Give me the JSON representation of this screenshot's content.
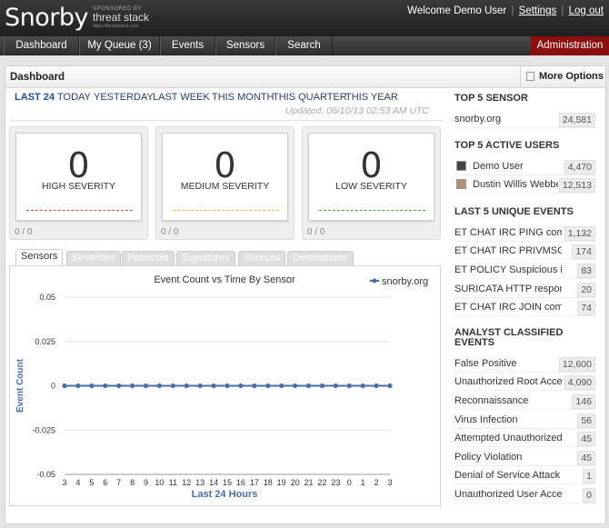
{
  "app": {
    "logo": "Snorby",
    "sponsor_small": "SPONSORED BY",
    "sponsor_brand": "threat stack",
    "sponsor_url": "https://threatstack.com",
    "welcome": "Welcome Demo User",
    "settings_link": "Settings",
    "logout_link": "Log out"
  },
  "nav": {
    "items": [
      "Dashboard",
      "My Queue (3)",
      "Events",
      "Sensors",
      "Search"
    ],
    "admin": "Administration"
  },
  "panel": {
    "title": "Dashboard",
    "more_options": "More Options"
  },
  "time_filters": [
    "LAST 24",
    "TODAY",
    "YESTERDAY",
    "LAST WEEK",
    "THIS MONTH",
    "THIS QUARTER",
    "THIS YEAR"
  ],
  "updated": "Updated: 06/10/13 02:53 AM UTC",
  "severities": [
    {
      "count": "0",
      "label": "HIGH SEVERITY",
      "ratio": "0 / 0",
      "color": "#d9534f"
    },
    {
      "count": "0",
      "label": "MEDIUM SEVERITY",
      "ratio": "0 / 0",
      "color": "#e6b949"
    },
    {
      "count": "0",
      "label": "LOW SEVERITY",
      "ratio": "0 / 0",
      "color": "#5a9a4a"
    }
  ],
  "tabs": [
    "Sensors",
    "Severities",
    "Protocols",
    "Signatures",
    "Sources",
    "Destinations"
  ],
  "chart_data": {
    "type": "line",
    "title": "Event Count vs Time By Sensor",
    "xlabel": "Last 24 Hours",
    "ylabel": "Event Count",
    "categories": [
      "3",
      "4",
      "5",
      "6",
      "7",
      "8",
      "9",
      "10",
      "11",
      "12",
      "13",
      "14",
      "15",
      "16",
      "17",
      "18",
      "19",
      "20",
      "21",
      "22",
      "23",
      "0",
      "1",
      "2",
      "3"
    ],
    "series": [
      {
        "name": "snorby.org",
        "values": [
          0,
          0,
          0,
          0,
          0,
          0,
          0,
          0,
          0,
          0,
          0,
          0,
          0,
          0,
          0,
          0,
          0,
          0,
          0,
          0,
          0,
          0,
          0,
          0,
          0
        ],
        "color": "#4a6fa5"
      }
    ],
    "ylim": [
      -0.05,
      0.05
    ],
    "yticks": [
      "0.05",
      "0.025",
      "0",
      "-0.025",
      "-0.05"
    ],
    "grid": true,
    "legend": "top-right"
  },
  "sidebar": {
    "top_sensor": {
      "title": "TOP 5 SENSOR",
      "rows": [
        {
          "name": "snorby.org",
          "value": "24,581"
        }
      ]
    },
    "top_users": {
      "title": "TOP 5 ACTIVE USERS",
      "rows": [
        {
          "name": "Demo User",
          "value": "4,470"
        },
        {
          "name": "Dustin Willis Webber",
          "value": "12,513"
        }
      ]
    },
    "unique_events": {
      "title": "LAST 5 UNIQUE EVENTS",
      "rows": [
        {
          "name": "ET CHAT IRC PING command",
          "value": "1,132"
        },
        {
          "name": "ET CHAT IRC PRIVMSG",
          "value": "174"
        },
        {
          "name": "ET POLICY Suspicious inbound",
          "value": "83"
        },
        {
          "name": "SURICATA HTTP response field",
          "value": "20"
        },
        {
          "name": "ET CHAT IRC JOIN command",
          "value": "74"
        }
      ]
    },
    "classified": {
      "title": "ANALYST CLASSIFIED EVENTS",
      "rows": [
        {
          "name": "False Positive",
          "value": "12,600"
        },
        {
          "name": "Unauthorized Root Access",
          "value": "4,090"
        },
        {
          "name": "Reconnaissance",
          "value": "146"
        },
        {
          "name": "Virus Infection",
          "value": "56"
        },
        {
          "name": "Attempted Unauthorized...",
          "value": "45"
        },
        {
          "name": "Policy Violation",
          "value": "45"
        },
        {
          "name": "Denial of Service Attack",
          "value": "1"
        },
        {
          "name": "Unauthorized User Access",
          "value": "0"
        }
      ]
    }
  }
}
